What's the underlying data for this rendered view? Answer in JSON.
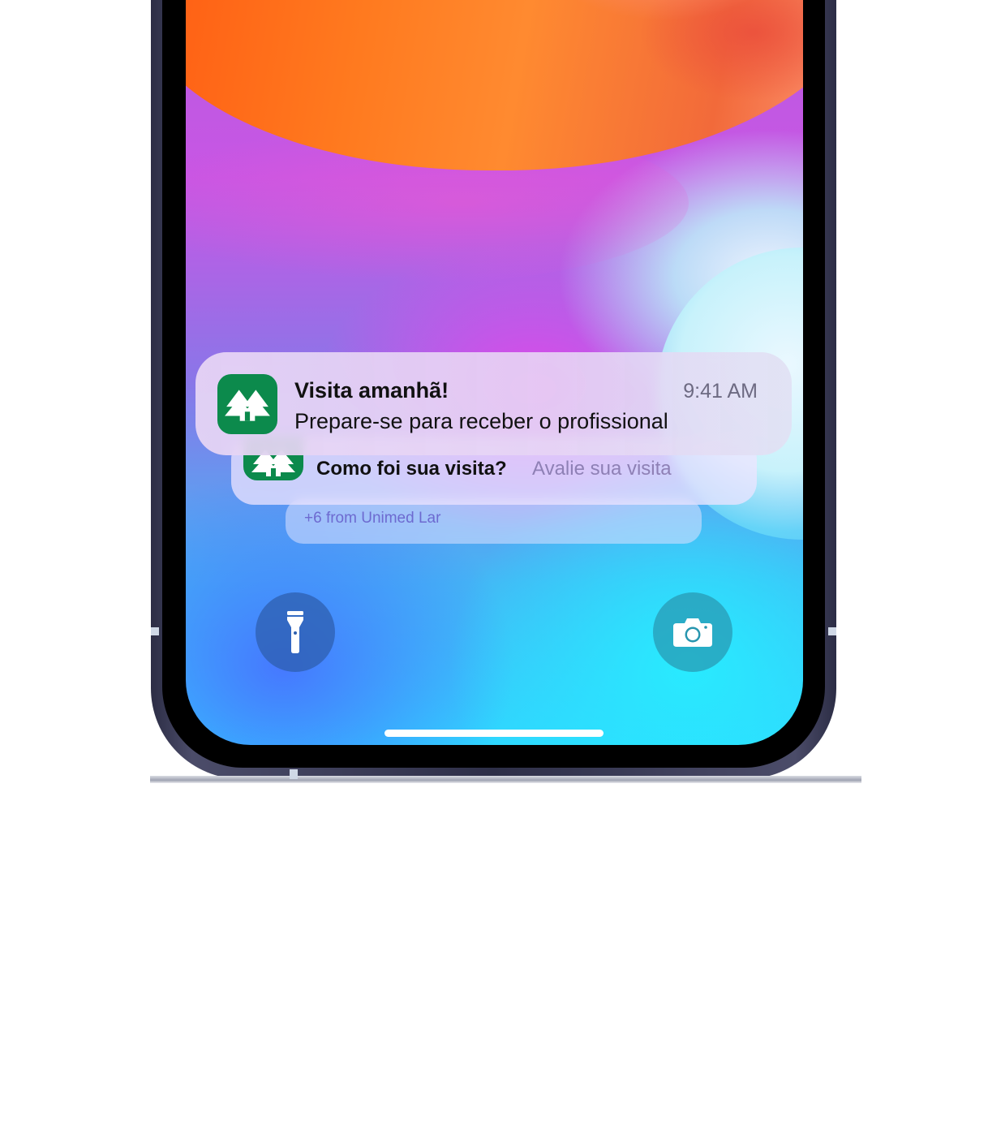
{
  "notifications": {
    "primary": {
      "app_icon": "unimed-lar-house-icon",
      "title": "Visita amanhã!",
      "time": "9:41 AM",
      "body": "Prepare-se para receber o profissional"
    },
    "secondary": {
      "app_icon": "unimed-lar-house-icon",
      "title": "Como foi sua visita?",
      "body": "Avalie sua visita"
    },
    "stack_summary": "+6 from Unimed Lar"
  },
  "lock_screen": {
    "left_control": "flashlight-icon",
    "right_control": "camera-icon"
  },
  "colors": {
    "app_icon_background": "#0c8a4c"
  }
}
